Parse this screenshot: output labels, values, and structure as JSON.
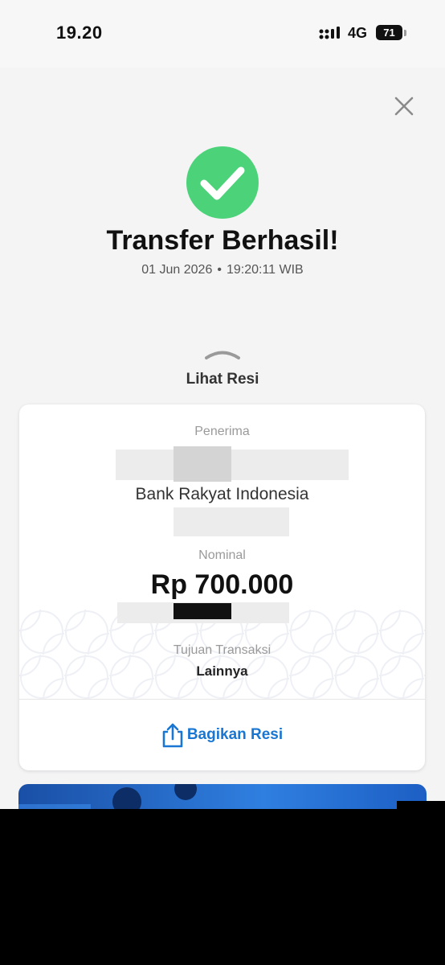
{
  "status_bar": {
    "time": "19.20",
    "network": "4G",
    "battery": "71"
  },
  "result": {
    "title": "Transfer Berhasil!",
    "date": "01 Jun 2026",
    "separator": "•",
    "time": "19:20:11 WIB",
    "view_receipt": "Lihat Resi"
  },
  "receipt": {
    "recipient_label": "Penerima",
    "bank": "Bank Rakyat Indonesia",
    "amount_label": "Nominal",
    "amount": "Rp 700.000",
    "purpose_label": "Tujuan Transaksi",
    "purpose": "Lainnya",
    "share_label": "Bagikan Resi"
  },
  "colors": {
    "success": "#4cd37a",
    "accent": "#1976d2"
  },
  "icons": [
    "close-icon",
    "check-icon",
    "chevron-up-icon",
    "share-icon",
    "signal-icon",
    "battery-icon"
  ]
}
